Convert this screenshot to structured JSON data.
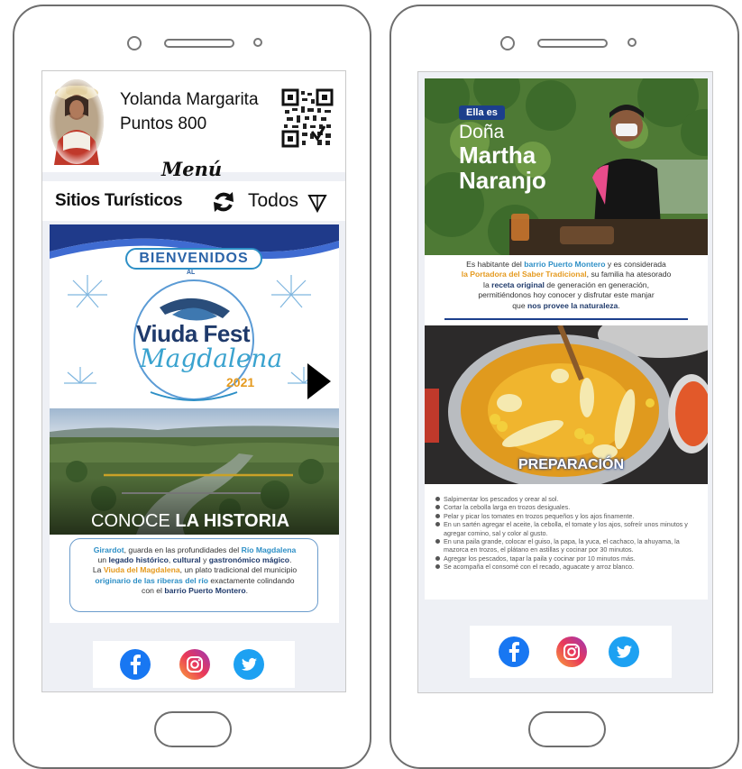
{
  "left_phone": {
    "user": {
      "name": "Yolanda Margarita",
      "points": "Puntos 800"
    },
    "menu_title": "Menú",
    "category": "Sitios Turísticos",
    "filter": "Todos",
    "banner": {
      "welcome": "BIENVENIDOS",
      "al": "AL",
      "logo_line1": "Viuda Fest",
      "logo_line2": "Magdalena",
      "year": "2021"
    },
    "history": {
      "title_light": "CONOCE",
      "title_bold": "LA HISTORIA",
      "p1_a": "Girardot",
      "p1_b": ", guarda en las profundidades del ",
      "p1_c": "Río Magdalena",
      "p2_a": "un ",
      "p2_b": "legado histórico",
      "p2_c": ", ",
      "p2_d": "cultural",
      "p2_e": " y ",
      "p2_f": "gastronómico mágico",
      "p2_g": ".",
      "p3_a": "La ",
      "p3_b": "Viuda del Magdalena",
      "p3_c": ", un plato tradicional del municipio",
      "p4_a": "originario de las riberas del río",
      "p4_b": " exactamente colindando",
      "p5_a": "con el ",
      "p5_b": "barrio Puerto Montero",
      "p5_c": "."
    }
  },
  "right_phone": {
    "badge": "Ella es",
    "title_1": "Doña",
    "title_2": "Martha",
    "title_3": "Naranjo",
    "story": {
      "l1_a": "Es habitante del ",
      "l1_b": "barrio Puerto Montero",
      "l1_c": " y es considerada",
      "l2_a": "la Portadora del Saber Tradicional",
      "l2_b": ", su familia ha atesorado",
      "l3_a": "la ",
      "l3_b": "receta original",
      "l3_c": " de generación en generación,",
      "l4": "permitiéndonos hoy conocer y disfrutar este manjar",
      "l5_a": "que ",
      "l5_b": "nos provee la naturaleza",
      "l5_c": "."
    },
    "prep_label": "PREPARACIÓN",
    "steps": [
      "Salpimentar los pescados y orear al sol.",
      "Cortar la cebolla larga en trozos desiguales.",
      "Pelar y picar los tomates en trozos pequeños y los ajos finamente.",
      "En un sartén agregar el aceite, la cebolla, el tomate y los ajos, sofreír unos minutos y agregar comino, sal y color al gusto.",
      "En una paila grande, colocar el guiso, la papa, la yuca, el cachaco, la ahuyama, la mazorca en trozos, el plátano en astillas y cocinar por 30 minutos.",
      "Agregar los pescados, tapar la paila y cocinar por 10 minutos más.",
      "Se acompaña el consomé con el recado, aguacate y arroz blanco."
    ]
  },
  "colors": {
    "accent_blue": "#2d8fc6",
    "accent_orange": "#e59a1f",
    "navy": "#1f3a6b",
    "facebook": "#1877f2",
    "twitter": "#1da1f2"
  },
  "icons": [
    "qr-code-icon",
    "refresh-icon",
    "filter-triangle-icon",
    "play-icon",
    "facebook-icon",
    "instagram-icon",
    "twitter-icon"
  ]
}
